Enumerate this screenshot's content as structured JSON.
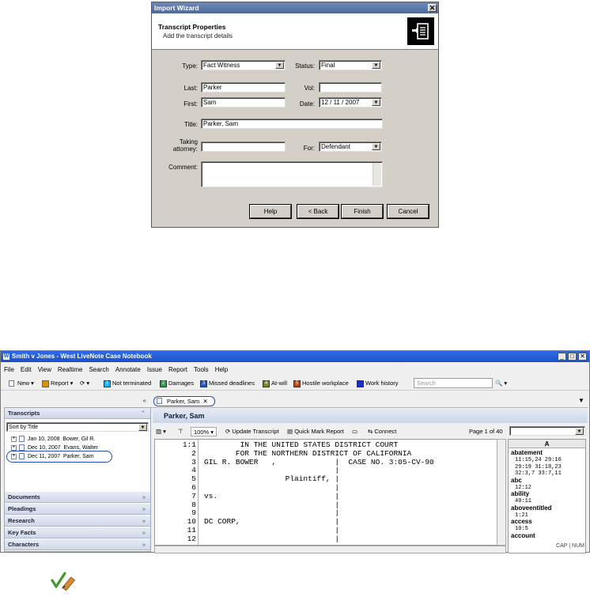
{
  "wizard": {
    "title": "Import Wizard",
    "close": "✕",
    "heading": "Transcript Properties",
    "subheading": "Add the transcript details",
    "labels": {
      "type": "Type:",
      "status": "Status:",
      "last": "Last:",
      "vol": "Vol:",
      "first": "First:",
      "date": "Date:",
      "title": "Title:",
      "taking_attorney": "Taking attorney:",
      "for": "For:",
      "comment": "Comment:"
    },
    "values": {
      "type": "Fact Witness",
      "status": "Final",
      "last": "Parker",
      "vol": "",
      "first": "Sam",
      "date": "12 / 11 / 2007",
      "title": "Parker, Sam",
      "taking_attorney": "",
      "for": "Defendant",
      "comment": ""
    },
    "buttons": {
      "help": "Help",
      "back": "< Back",
      "finish": "Finish",
      "cancel": "Cancel"
    }
  },
  "app": {
    "title": "Smith v Jones - West LiveNote Case Notebook",
    "menu": [
      "File",
      "Edit",
      "View",
      "Realtime",
      "Search",
      "Annotate",
      "Issue",
      "Report",
      "Tools",
      "Help"
    ],
    "toolbar": {
      "new": "New",
      "report": "Report",
      "issues": [
        {
          "num": "1",
          "label": "Not terminated",
          "color": "#2ab0e8"
        },
        {
          "num": "2",
          "label": "Damages",
          "color": "#2f9e48"
        },
        {
          "num": "3",
          "label": "Missed deadlines",
          "color": "#2255c8"
        },
        {
          "num": "4",
          "label": "At-will",
          "color": "#7a8a22"
        },
        {
          "num": "5",
          "label": "Hostile workplace",
          "color": "#b3481f"
        },
        {
          "num": "",
          "label": "Work history",
          "color": "#1b2fc8"
        }
      ],
      "search_placeholder": "Search"
    },
    "left": {
      "transcripts_header": "Transcripts",
      "sort": "Sort by Title",
      "items": [
        {
          "date": "Jan 10, 2008",
          "name": "Bower, Gil R."
        },
        {
          "date": "Dec 10, 2007",
          "name": "Evans, Walter"
        },
        {
          "date": "Dec 11, 2007",
          "name": "Parker, Sam"
        }
      ],
      "sections": [
        "Documents",
        "Pleadings",
        "Research",
        "Key Facts",
        "Characters"
      ]
    },
    "tab": "Parker, Sam",
    "doc_header": "Parker, Sam",
    "viewer": {
      "zoom": "100%",
      "update": "Update Transcript",
      "quick_mark": "Quick Mark Report",
      "connect": "Connect",
      "page": "Page 1 of 40"
    },
    "transcript_lines": [
      {
        "n": "1:1",
        "t": "        IN THE UNITED STATES DISTRICT COURT"
      },
      {
        "n": "2",
        "t": "       FOR THE NORTHERN DISTRICT OF CALIFORNIA"
      },
      {
        "n": "3",
        "t": "GIL R. BOWER   ,             |  CASE NO. 3:05-CV-90"
      },
      {
        "n": "4",
        "t": "                             |"
      },
      {
        "n": "5",
        "t": "                  Plaintiff, |"
      },
      {
        "n": "6",
        "t": "                             |"
      },
      {
        "n": "7",
        "t": "vs.                          |"
      },
      {
        "n": "8",
        "t": "                             |"
      },
      {
        "n": "9",
        "t": "                             |"
      },
      {
        "n": "10",
        "t": "DC CORP,                     |"
      },
      {
        "n": "11",
        "t": "                             |"
      },
      {
        "n": "12",
        "t": "                             |"
      }
    ],
    "index": {
      "letter": "A",
      "entries": [
        {
          "w": "abatement",
          "refs": [
            "11:15,24 29:16",
            "29:19 31:18,23",
            "32:3,7 33:7,11"
          ]
        },
        {
          "w": "abc",
          "refs": [
            "12:12"
          ]
        },
        {
          "w": "ability",
          "refs": [
            "40:11"
          ]
        },
        {
          "w": "aboveentitled",
          "refs": [
            "1:21"
          ]
        },
        {
          "w": "access",
          "refs": [
            "10:5"
          ]
        },
        {
          "w": "account",
          "refs": []
        }
      ]
    },
    "status": {
      "cap": "CAP",
      "num": "NUM"
    }
  }
}
